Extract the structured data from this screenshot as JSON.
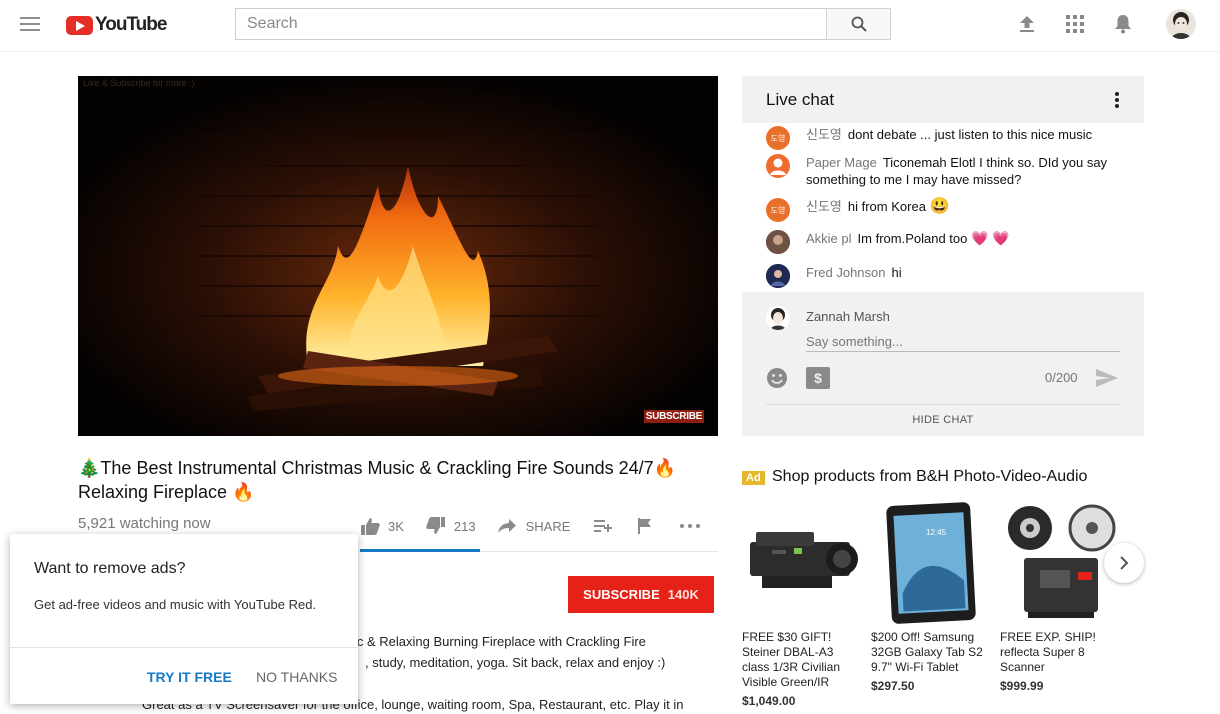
{
  "header": {
    "logo_text": "YouTube",
    "search_placeholder": "Search"
  },
  "player": {
    "caption": "Like & Subscribe for more :)",
    "subscribe_watermark": "SUBSCRIBE"
  },
  "video": {
    "title_line1": "The Best Instrumental Christmas Music & Crackling Fire Sounds 24/7",
    "title_line2": "Relaxing Fireplace",
    "title_emoji_tree": "🎄",
    "title_emoji_fire": "🔥",
    "watching": "5,921 watching now",
    "likes": "3K",
    "dislikes": "213",
    "share_label": "SHARE",
    "likes_ratio": 0.934
  },
  "channel": {
    "subscribe_label": "SUBSCRIBE",
    "subscriber_count": "140K"
  },
  "description": {
    "line1": "ic & Relaxing Burning Fireplace with Crackling Fire",
    "line2": ", study, meditation, yoga. Sit back, relax and enjoy :)",
    "line3": "Great as a TV Screensaver for the office,  lounge, waiting room, Spa, Restaurant, etc. Play it in"
  },
  "chat": {
    "title": "Live chat",
    "messages": [
      {
        "author": "신도영",
        "text": "dont debate ... just listen to this nice music",
        "avatar_text": "도영",
        "avatar_color": "#e8702a"
      },
      {
        "author": "Paper Mage",
        "text": "Ticonemah Elotl I think so. DId you say something to me I may have missed?",
        "avatar_text": "",
        "avatar_color": "#ef6c2e"
      },
      {
        "author": "신도영",
        "text": "hi from Korea",
        "emoji": "😃",
        "avatar_text": "도영",
        "avatar_color": "#e8702a"
      },
      {
        "author": "Akkie pl",
        "text": "Im from.Poland too",
        "emoji": "💗 💗",
        "avatar_text": "",
        "avatar_color": "#7a5a4a"
      },
      {
        "author": "Fred Johnson",
        "text": "hi",
        "avatar_text": "",
        "avatar_color": "#2b3a6b"
      }
    ],
    "current_user": "Zannah Marsh",
    "input_placeholder": "Say something...",
    "counter": "0/200",
    "hide_label": "HIDE CHAT"
  },
  "shop": {
    "ad_badge": "Ad",
    "title": "Shop products from B&H Photo-Video-Audio",
    "products": [
      {
        "name_lines": [
          "FREE $30 GIFT!",
          "Steiner DBAL-A3",
          "class 1/3R Civilian",
          "Visible Green/IR"
        ],
        "price": "$1,049.00"
      },
      {
        "name_lines": [
          "$200 Off! Samsung",
          "32GB Galaxy Tab S2",
          "9.7\" Wi-Fi Tablet"
        ],
        "price": "$297.50"
      },
      {
        "name_lines": [
          "FREE EXP. SHIP!",
          "reflecta Super 8",
          "Scanner"
        ],
        "price": "$999.99"
      }
    ]
  },
  "popup": {
    "title": "Want to remove ads?",
    "body": "Get ad-free videos and music with YouTube Red.",
    "try_label": "TRY IT FREE",
    "no_label": "NO THANKS"
  },
  "colors": {
    "brand_red": "#e62117",
    "accent_blue": "#167ac6",
    "ad_yellow": "#e6b62c"
  }
}
